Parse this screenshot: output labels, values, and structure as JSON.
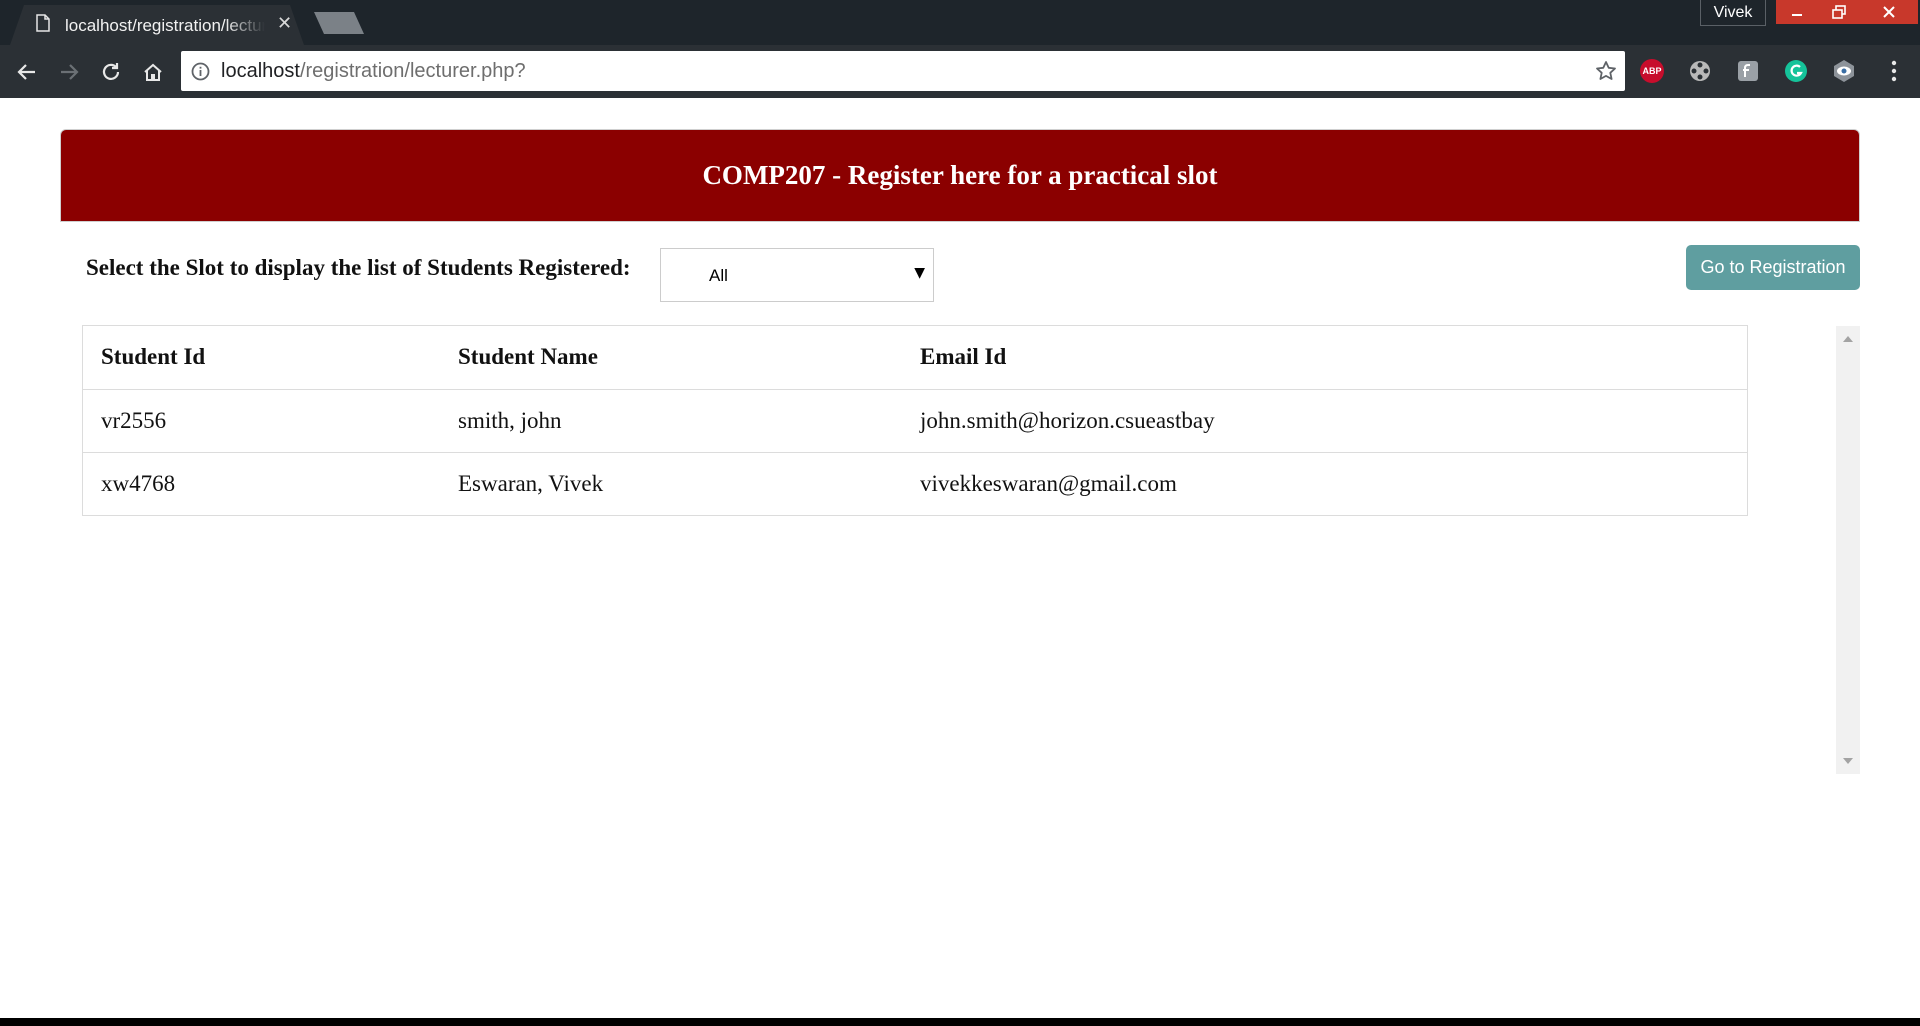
{
  "browser": {
    "tab_title": "localhost/registration/lecturer.php?",
    "tab_close": "✕",
    "profile_name": "Vivek",
    "url_host": "localhost",
    "url_path": "/registration/lecturer.php?",
    "extensions": {
      "abp_label": "ABP"
    }
  },
  "page": {
    "header_title": "COMP207 - Register here for a practical slot",
    "slot_label": "Select the Slot to display the list of Students Registered:",
    "slot_selected": "All",
    "go_button": "Go to Registration",
    "table": {
      "headers": [
        "Student Id",
        "Student Name",
        "Email Id"
      ],
      "rows": [
        [
          "vr2556",
          "smith, john",
          "john.smith@horizon.csueastbay"
        ],
        [
          "xw4768",
          "Eswaran, Vivek",
          "vivekkeswaran@gmail.com"
        ]
      ]
    }
  },
  "colors": {
    "header_bg": "#8b0000",
    "button_bg": "#5f9ea0",
    "chrome_dark": "#1e252b",
    "window_close": "#c8382b"
  }
}
